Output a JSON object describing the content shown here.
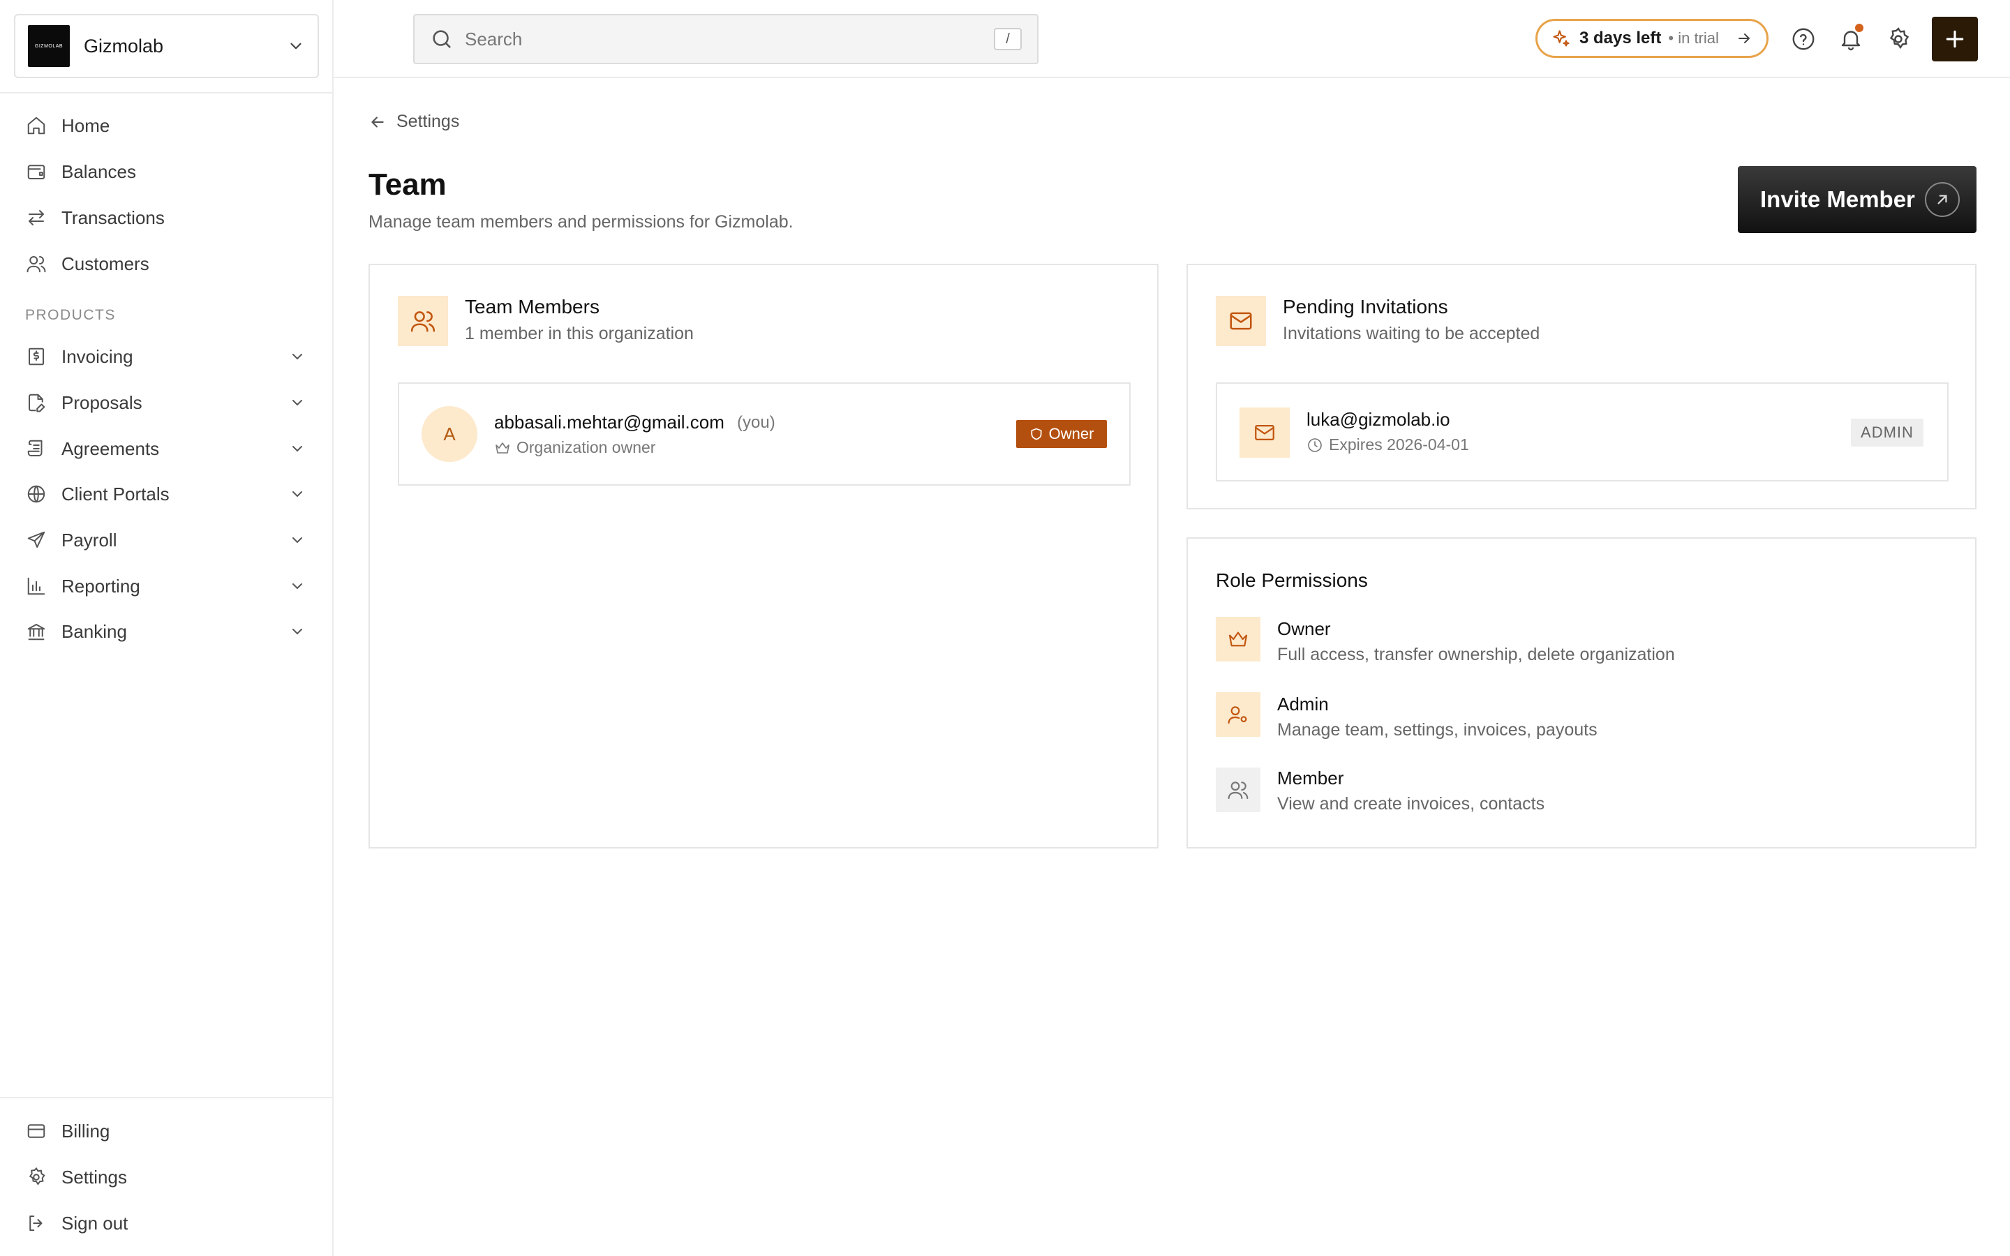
{
  "org": {
    "name": "Gizmolab",
    "logo_text": "GIZMOLAB"
  },
  "sidebar": {
    "main_items": [
      {
        "label": "Home",
        "icon": "home-icon"
      },
      {
        "label": "Balances",
        "icon": "wallet-icon"
      },
      {
        "label": "Transactions",
        "icon": "arrows-exchange-icon"
      },
      {
        "label": "Customers",
        "icon": "users-icon"
      }
    ],
    "section_label": "PRODUCTS",
    "product_items": [
      {
        "label": "Invoicing",
        "icon": "invoice-dollar-icon"
      },
      {
        "label": "Proposals",
        "icon": "file-edit-icon"
      },
      {
        "label": "Agreements",
        "icon": "scroll-icon"
      },
      {
        "label": "Client Portals",
        "icon": "globe-icon"
      },
      {
        "label": "Payroll",
        "icon": "send-icon"
      },
      {
        "label": "Reporting",
        "icon": "bar-chart-icon"
      },
      {
        "label": "Banking",
        "icon": "bank-icon"
      }
    ],
    "bottom_items": [
      {
        "label": "Billing",
        "icon": "credit-card-icon"
      },
      {
        "label": "Settings",
        "icon": "gear-icon"
      },
      {
        "label": "Sign out",
        "icon": "sign-out-icon"
      }
    ]
  },
  "topbar": {
    "search_placeholder": "Search",
    "search_shortcut": "/",
    "trial_strong": "3 days left",
    "trial_muted": "• in trial"
  },
  "page": {
    "back_label": "Settings",
    "title": "Team",
    "subtitle": "Manage team members and permissions for Gizmolab.",
    "invite_label": "Invite Member"
  },
  "team_members": {
    "title": "Team Members",
    "subtitle": "1 member in this organization",
    "members": [
      {
        "initial": "A",
        "email": "abbasali.mehtar@gmail.com",
        "you_label": "(you)",
        "role_text": "Organization owner",
        "badge": "Owner"
      }
    ]
  },
  "pending": {
    "title": "Pending Invitations",
    "subtitle": "Invitations waiting to be accepted",
    "invites": [
      {
        "email": "luka@gizmolab.io",
        "expires": "Expires 2026-04-01",
        "role": "ADMIN"
      }
    ]
  },
  "roles": {
    "title": "Role Permissions",
    "items": [
      {
        "name": "Owner",
        "desc": "Full access, transfer ownership, delete organization",
        "icon": "crown-icon"
      },
      {
        "name": "Admin",
        "desc": "Manage team, settings, invoices, payouts",
        "icon": "user-cog-icon"
      },
      {
        "name": "Member",
        "desc": "View and create invoices, contacts",
        "icon": "users-icon"
      }
    ]
  },
  "colors": {
    "accent": "#b4500f",
    "accent_soft": "#fde9cc",
    "trial_border": "#e8a34a",
    "plus_button": "#2a1a06",
    "notification_dot": "#d4621a"
  }
}
